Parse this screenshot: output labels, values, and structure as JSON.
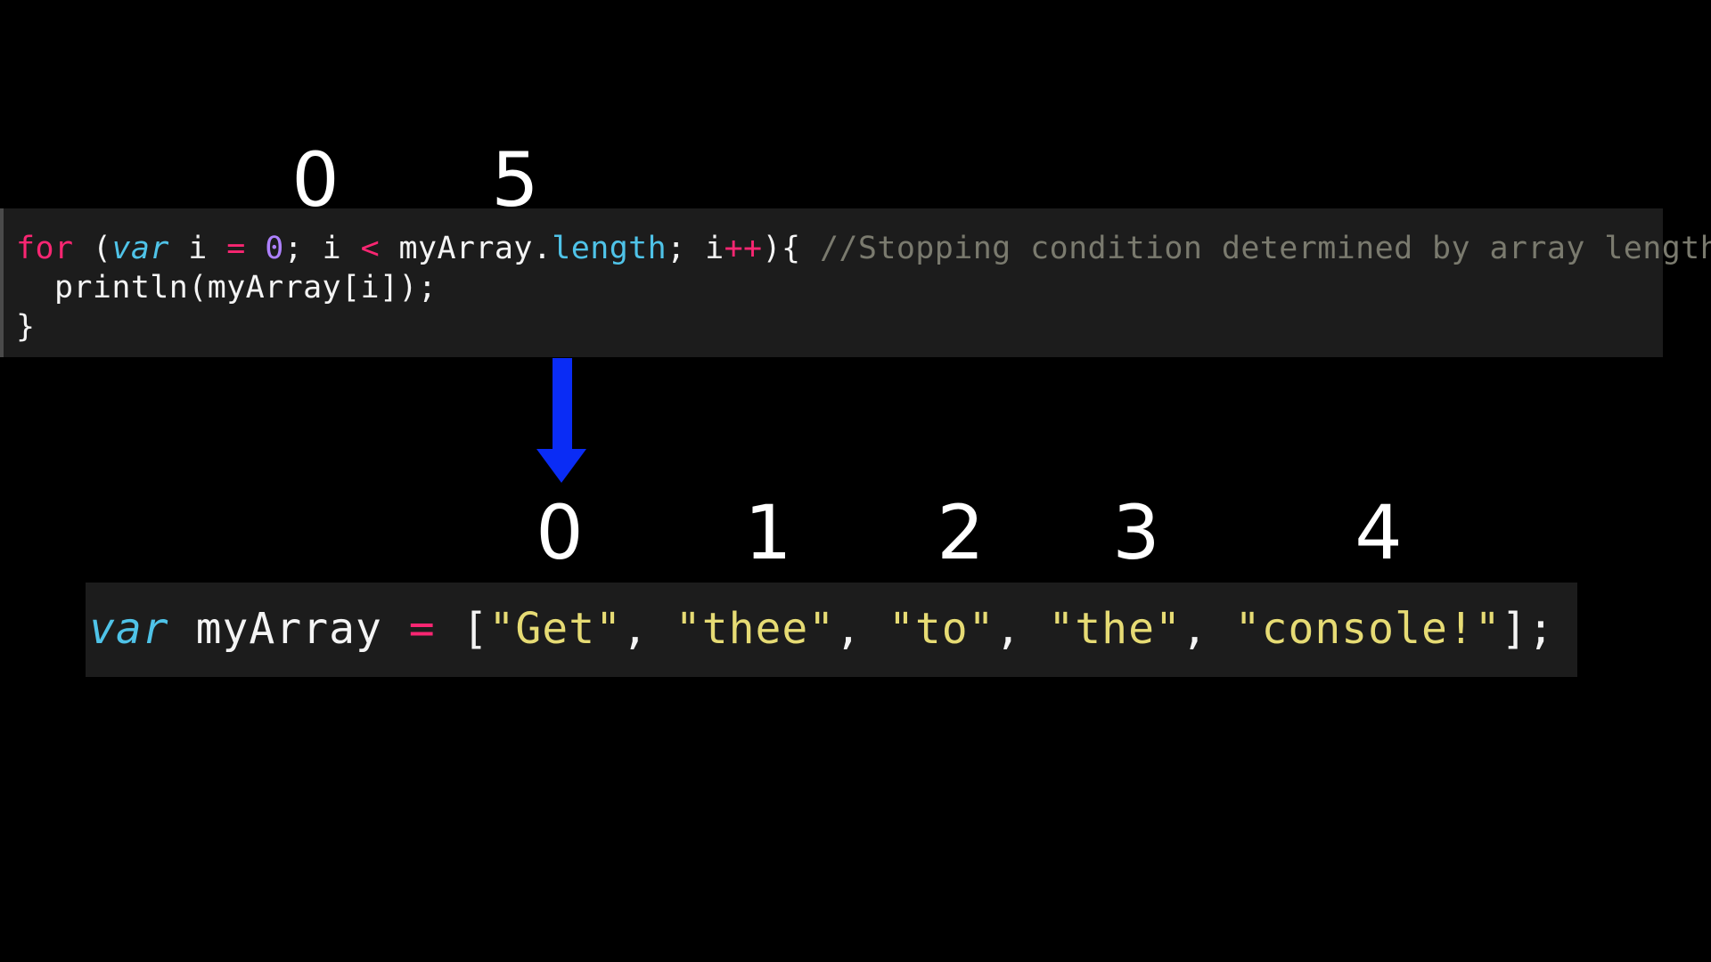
{
  "top_labels": {
    "start": "0",
    "end": "5"
  },
  "for_loop": {
    "line1": {
      "kw_for": "for",
      "paren_open": " (",
      "kw_var": "var",
      "sp_i": " i ",
      "op_eq": "=",
      "sp1": " ",
      "zero": "0",
      "cond_a": "; i ",
      "op_lt": "<",
      "cond_b": " myArray.",
      "prop_length": "length",
      "cond_c": "; i",
      "op_inc": "++",
      "close": "){ ",
      "comment": "//Stopping condition determined by array length"
    },
    "line2": "  println(myArray[i]);",
    "line3": "}"
  },
  "arrow": {
    "color": "#0a2cf5",
    "icon": "down-arrow-icon"
  },
  "index_labels": [
    "0",
    "1",
    "2",
    "3",
    "4"
  ],
  "array_decl": {
    "kw_var": "var",
    "name": " myArray ",
    "op_eq": "=",
    "open": " [",
    "items": [
      "\"Get\"",
      "\"thee\"",
      "\"to\"",
      "\"the\"",
      "\"console!\""
    ],
    "sep": ", ",
    "close": "];"
  },
  "colors": {
    "background": "#000000",
    "code_bg": "#1c1c1c",
    "keyword": "#f92672",
    "italic_keyword": "#4fc3e8",
    "number": "#ae81ff",
    "string": "#e6db74",
    "comment": "#7a7a6e"
  }
}
